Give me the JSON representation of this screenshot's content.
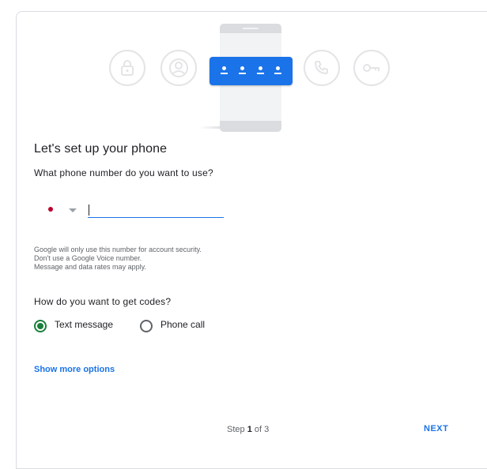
{
  "setup": {
    "title": "Let's set up your phone",
    "phone_question": "What phone number do you want to use?",
    "phone_input": {
      "value": "",
      "placeholder": ""
    },
    "country_selector": {
      "flag_icon": "japan-flag-icon",
      "flag_color": "#bc002d"
    },
    "notes": [
      "Google will only use this number for account security.",
      "Don't use a Google Voice number.",
      "Message and data rates may apply."
    ],
    "codes_question": "How do you want to get codes?",
    "options": [
      {
        "label": "Text message",
        "checked": true
      },
      {
        "label": "Phone call",
        "checked": false
      }
    ],
    "more_options_link": "Show more options",
    "step": {
      "prefix": "Step",
      "current": "1",
      "separator": "of",
      "total": "3"
    },
    "next_button": "NEXT"
  },
  "illustration": {
    "icons": [
      "lock-icon",
      "account-circle-icon",
      "code-dots-icon",
      "phone-icon",
      "key-icon"
    ],
    "accent_color": "#1a73e8"
  },
  "colors": {
    "primary": "#1a73e8",
    "radio_checked": "#188038",
    "icon_outline": "#e3e4e6"
  }
}
